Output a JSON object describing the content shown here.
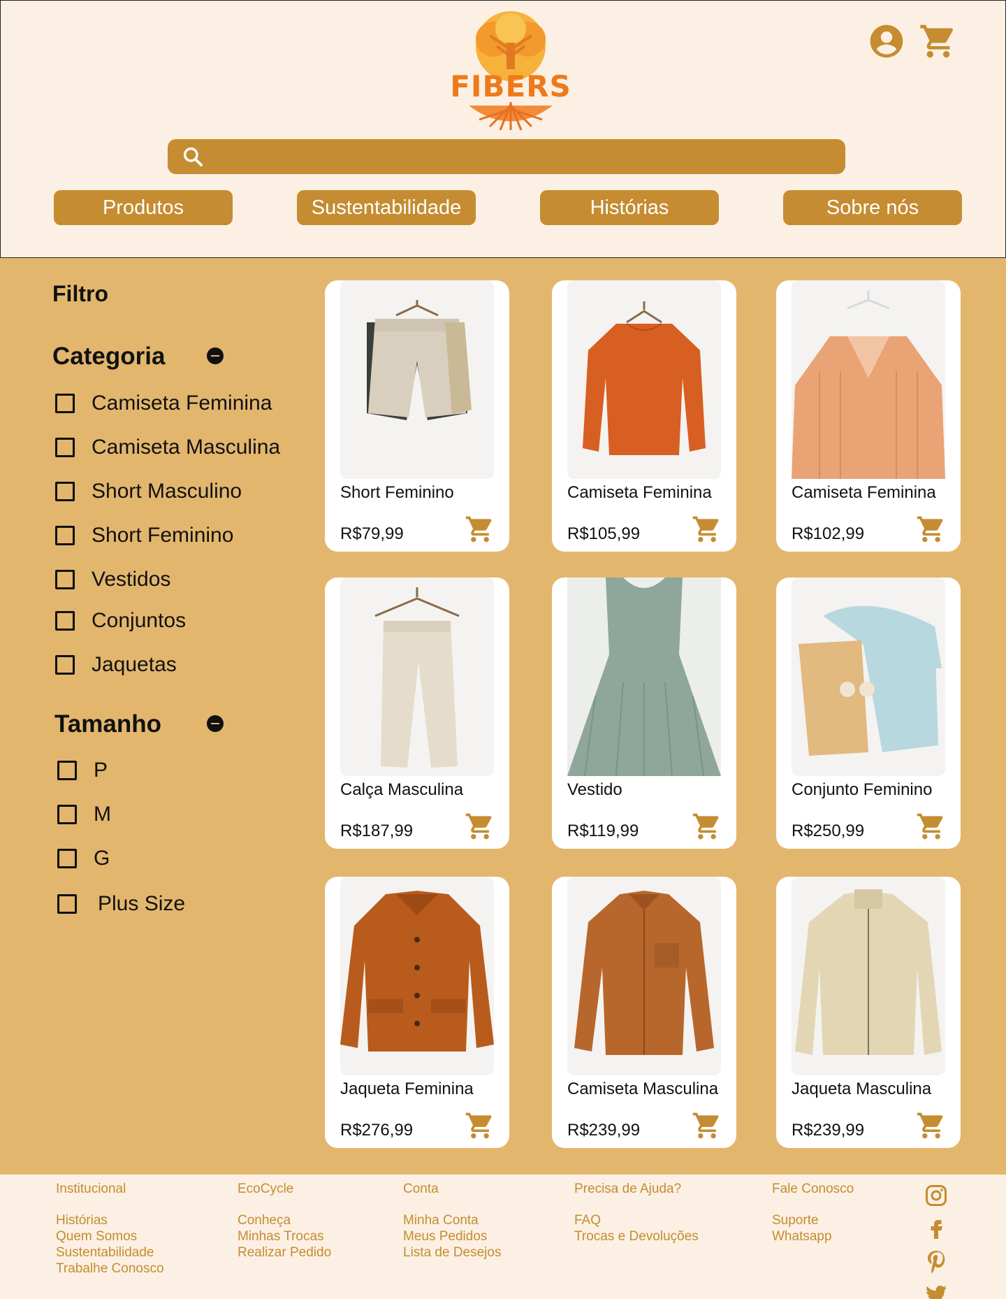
{
  "brand": {
    "name": "FIBERS",
    "primary_color": "#c58c31",
    "logo_color": "#ee7a1c",
    "background": "#e3b66e",
    "header_bg": "#fbf0e3"
  },
  "header": {
    "icons": [
      "account-icon",
      "cart-icon"
    ],
    "search": {
      "placeholder": ""
    }
  },
  "nav": [
    {
      "label": "Produtos"
    },
    {
      "label": "Sustentabilidade"
    },
    {
      "label": "Histórias"
    },
    {
      "label": "Sobre nós"
    }
  ],
  "filter": {
    "title": "Filtro",
    "categoria": {
      "title": "Categoria",
      "options": [
        "Camiseta Feminina",
        "Camiseta Masculina",
        "Short Masculino",
        "Short Feminino",
        "Vestidos",
        "Conjuntos",
        "Jaquetas"
      ]
    },
    "tamanho": {
      "title": "Tamanho",
      "options": [
        "P",
        "M",
        "G",
        "Plus Size"
      ]
    }
  },
  "products": [
    {
      "name": "Short Feminino",
      "price": "R$79,99"
    },
    {
      "name": "Camiseta Feminina",
      "price": "R$105,99"
    },
    {
      "name": "Camiseta Feminina",
      "price": "R$102,99"
    },
    {
      "name": "Calça Masculina",
      "price": "R$187,99"
    },
    {
      "name": "Vestido",
      "price": "R$119,99"
    },
    {
      "name": "Conjunto Feminino",
      "price": "R$250,99"
    },
    {
      "name": "Jaqueta Feminina",
      "price": "R$276,99"
    },
    {
      "name": "Camiseta Masculina",
      "price": "R$239,99"
    },
    {
      "name": "Jaqueta Masculina",
      "price": "R$239,99"
    }
  ],
  "footer": {
    "columns": [
      {
        "heading": "Institucional",
        "links": [
          "Histórias",
          "Quem Somos",
          "Sustentabilidade",
          "Trabalhe Conosco"
        ]
      },
      {
        "heading": "EcoCycle",
        "links": [
          "Conheça",
          "Minhas Trocas",
          "Realizar Pedido"
        ]
      },
      {
        "heading": "Conta",
        "links": [
          "Minha Conta",
          "Meus Pedidos",
          "Lista de Desejos"
        ]
      },
      {
        "heading": "Precisa de Ajuda?",
        "links": [
          "FAQ",
          "Trocas e Devoluções"
        ]
      },
      {
        "heading": "Fale Conosco",
        "links": [
          "Suporte",
          "Whatsapp"
        ]
      }
    ],
    "social": [
      "instagram-icon",
      "facebook-icon",
      "pinterest-icon",
      "twitter-icon"
    ]
  }
}
